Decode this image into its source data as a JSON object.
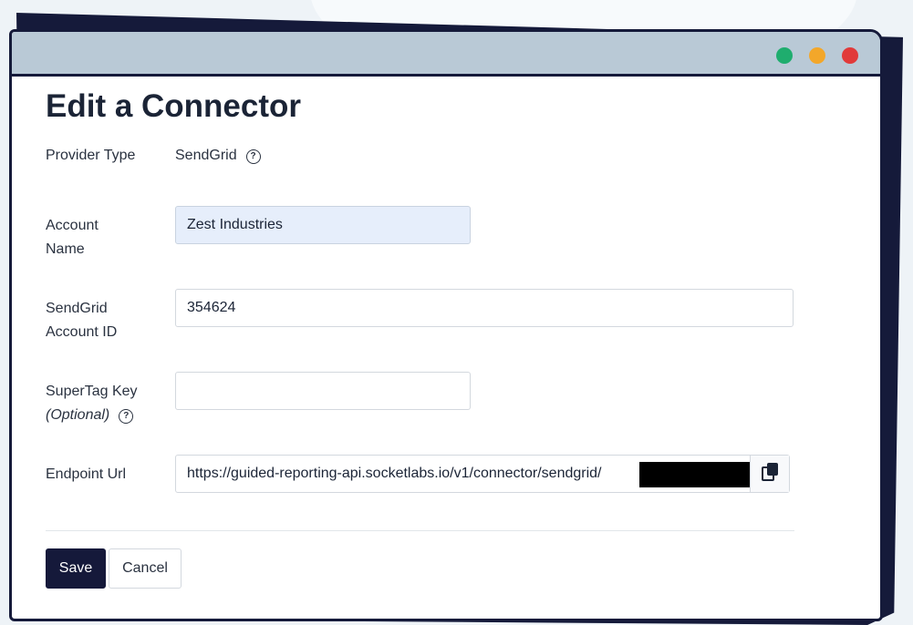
{
  "page": {
    "title": "Edit a Connector"
  },
  "window_controls": {
    "green": "#1fad6e",
    "yellow": "#f3a72a",
    "red": "#e13a3a"
  },
  "form": {
    "provider_type": {
      "label": "Provider Type",
      "value": "SendGrid",
      "help_icon": "question-circle-icon"
    },
    "account_name": {
      "label_line1": "Account",
      "label_line2": "Name",
      "value": "Zest Industries"
    },
    "sendgrid_account_id": {
      "label_line1": "SendGrid",
      "label_line2": "Account ID",
      "value": "354624"
    },
    "supertag_key": {
      "label_line1": "SuperTag Key",
      "label_line2": "(Optional)",
      "value": "",
      "help_icon": "question-circle-icon"
    },
    "endpoint_url": {
      "label": "Endpoint Url",
      "value": "https://guided-reporting-api.socketlabs.io/v1/connector/sendgrid/",
      "copy_icon": "copy-icon"
    }
  },
  "actions": {
    "save_label": "Save",
    "cancel_label": "Cancel"
  },
  "colors": {
    "primary": "#15193a",
    "input_filled_bg": "#e6eefb",
    "titlebar": "#b9c9d6"
  }
}
